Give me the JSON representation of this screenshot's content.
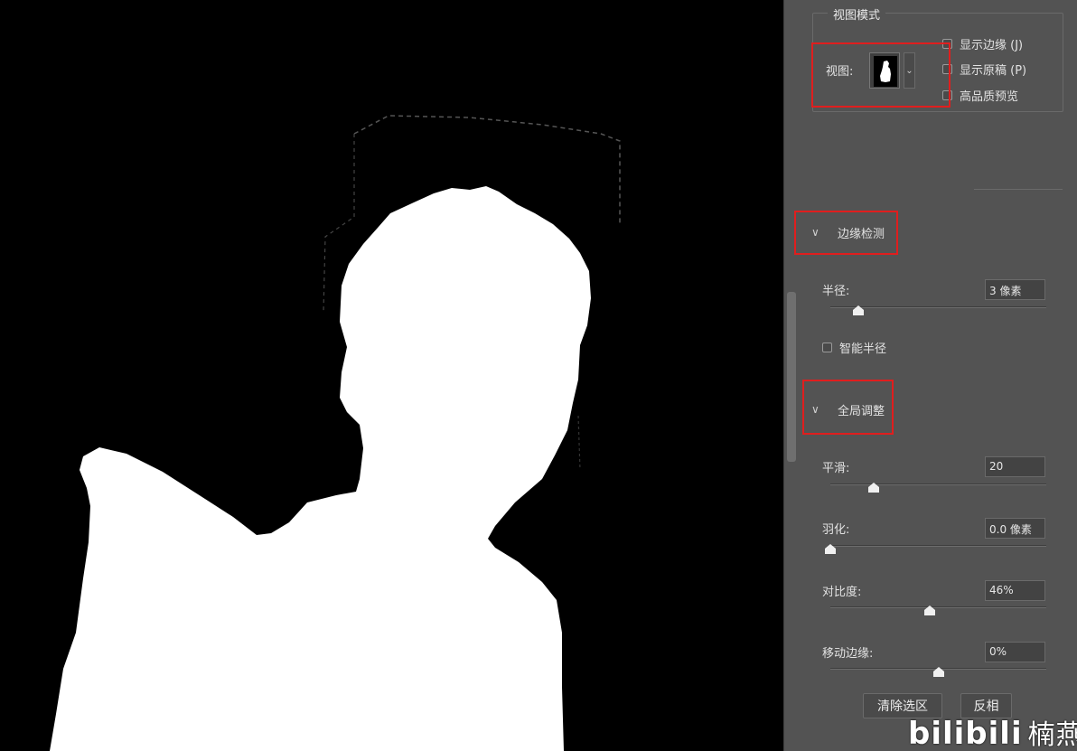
{
  "view_mode": {
    "section_title": "视图模式",
    "view_label": "视图:",
    "view_thumbnail_icon": "silhouette-thumbnail-icon",
    "dropdown_icon": "chevron-down-icon",
    "options": [
      {
        "label": "显示边缘 (J)",
        "checked": false
      },
      {
        "label": "显示原稿 (P)",
        "checked": false
      },
      {
        "label": "高品质预览",
        "checked": false
      }
    ]
  },
  "edge_detection": {
    "section_title": "边缘检测",
    "expanded": true,
    "radius_label": "半径:",
    "radius_value": "3 像素",
    "radius_level": 0.13,
    "smart_radius_label": "智能半径",
    "smart_radius_checked": false
  },
  "global_refine": {
    "section_title": "全局调整",
    "expanded": true,
    "sliders": [
      {
        "label": "平滑:",
        "value": "20",
        "level": 0.2
      },
      {
        "label": "羽化:",
        "value": "0.0 像素",
        "level": 0.0
      },
      {
        "label": "对比度:",
        "value": "46%",
        "level": 0.46
      },
      {
        "label": "移动边缘:",
        "value": "0%",
        "level": 0.5
      }
    ]
  },
  "buttons": {
    "clear_selection": "清除选区",
    "invert": "反相"
  },
  "watermark": {
    "logo": "bilibili",
    "author": "楠燕i"
  },
  "colors": {
    "panel_bg": "#535353",
    "highlight_red": "#e01e1e",
    "mask_white": "#ffffff",
    "mask_black": "#000000"
  }
}
